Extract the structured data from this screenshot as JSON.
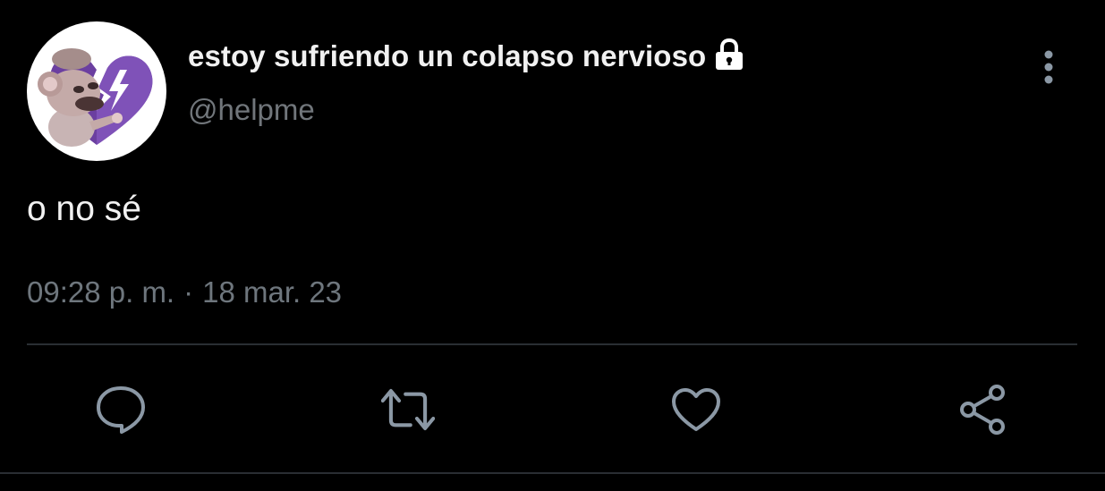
{
  "tweet": {
    "display_name": "estoy sufriendo un colapso nervioso",
    "handle": "@helpme",
    "text": "o no sé",
    "time": "09:28 p. m.",
    "separator": "·",
    "date": "18 mar. 23",
    "protected_icon": "lock-icon",
    "avatar_icon": "avatar-image"
  },
  "actions": [
    {
      "name": "reply",
      "icon": "comment-icon"
    },
    {
      "name": "retweet",
      "icon": "retweet-icon"
    },
    {
      "name": "like",
      "icon": "heart-icon"
    },
    {
      "name": "share",
      "icon": "share-icon"
    }
  ],
  "colors": {
    "background": "#000000",
    "primary_text": "#f1f1f1",
    "secondary_text": "#71767b",
    "icon": "#8b98a5",
    "divider": "#2a2e33",
    "avatar_heart": "#6b3fa0"
  }
}
